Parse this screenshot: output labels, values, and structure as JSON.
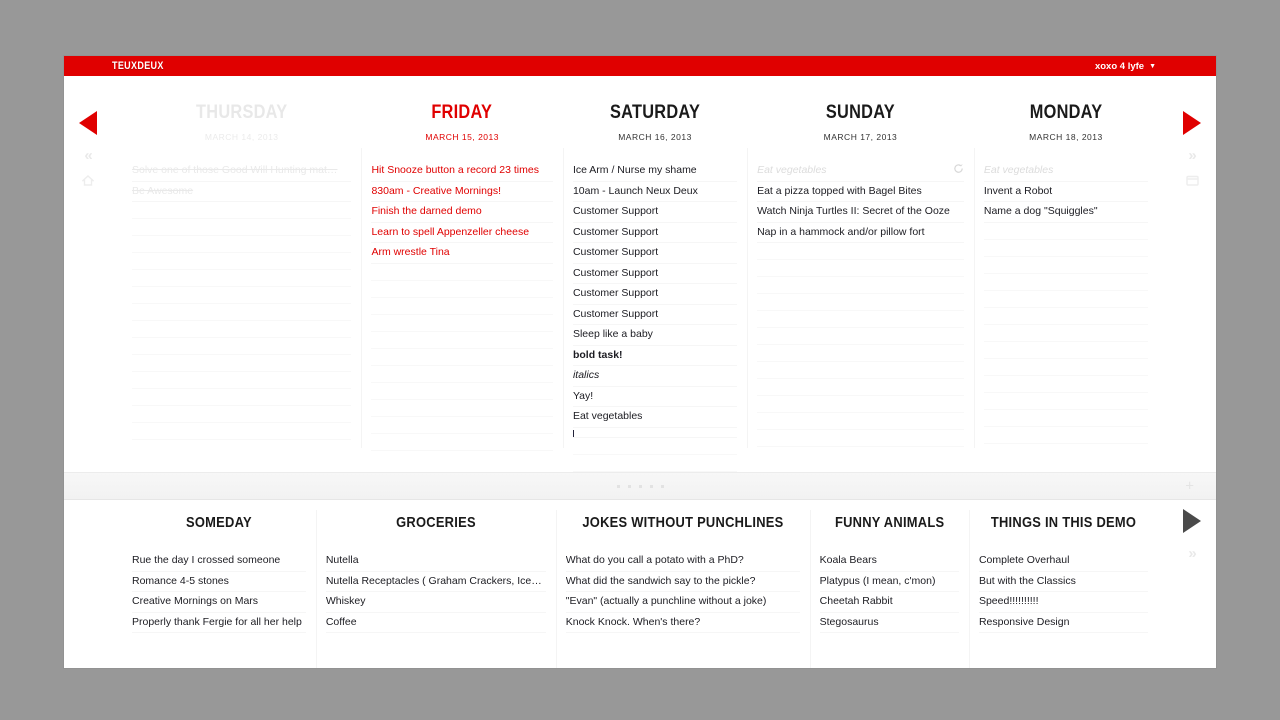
{
  "header": {
    "logo": "TEUXDEUX",
    "account_label": "xoxo 4 lyfe",
    "caret": "▼",
    "brand_color": "#e00000"
  },
  "nav": {
    "prev_week_icon": "chevron-left-icon",
    "next_week_icon": "chevron-right-icon",
    "prev_far_label": "«",
    "next_far_label": "»",
    "home_icon": "home-icon",
    "calendar_icon": "calendar-icon",
    "lists_next_label": "»"
  },
  "divider": {
    "add_label": "+",
    "grip_dots": 5
  },
  "days": [
    {
      "name": "THURSDAY",
      "date": "MARCH 14, 2013",
      "state": "past",
      "tasks": [
        {
          "text": "Solve one of those Good Will Hunting mat…",
          "style": "done"
        },
        {
          "text": "Be Awesome",
          "style": "done"
        }
      ]
    },
    {
      "name": "FRIDAY",
      "date": "MARCH 15, 2013",
      "state": "today",
      "tasks": [
        {
          "text": "Hit Snooze button a record 23 times",
          "style": "normal"
        },
        {
          "text": "830am - Creative Mornings!",
          "style": "normal"
        },
        {
          "text": "Finish the darned demo",
          "style": "normal"
        },
        {
          "text": "Learn to spell Appenzeller cheese",
          "style": "normal"
        },
        {
          "text": "Arm wrestle Tina",
          "style": "normal"
        }
      ]
    },
    {
      "name": "SATURDAY",
      "date": "MARCH 16, 2013",
      "state": "future",
      "tasks": [
        {
          "text": "Ice Arm / Nurse my shame",
          "style": "normal"
        },
        {
          "text": "10am - Launch Neux Deux",
          "style": "normal"
        },
        {
          "text": "Customer Support",
          "style": "normal"
        },
        {
          "text": "Customer Support",
          "style": "normal"
        },
        {
          "text": "Customer Support",
          "style": "normal"
        },
        {
          "text": "Customer Support",
          "style": "normal"
        },
        {
          "text": "Customer Support",
          "style": "normal"
        },
        {
          "text": "Customer Support",
          "style": "normal"
        },
        {
          "text": "Sleep like a baby",
          "style": "normal"
        },
        {
          "text": "bold task!",
          "style": "bold"
        },
        {
          "text": "italics",
          "style": "italic"
        },
        {
          "text": "Yay!",
          "style": "normal"
        },
        {
          "text": "Eat vegetables",
          "style": "normal"
        },
        {
          "text": "",
          "style": "editing"
        }
      ]
    },
    {
      "name": "SUNDAY",
      "date": "MARCH 17, 2013",
      "state": "future",
      "tasks": [
        {
          "text": "Eat vegetables",
          "style": "recurring",
          "icon": "repeat-icon"
        },
        {
          "text": "Eat a pizza topped with Bagel Bites",
          "style": "normal"
        },
        {
          "text": "Watch Ninja Turtles II: Secret of the Ooze",
          "style": "normal"
        },
        {
          "text": "Nap in a hammock and/or pillow fort",
          "style": "normal"
        }
      ]
    },
    {
      "name": "MONDAY",
      "date": "MARCH 18, 2013",
      "state": "future",
      "tasks": [
        {
          "text": "Eat vegetables",
          "style": "recurring"
        },
        {
          "text": "Invent a Robot",
          "style": "normal"
        },
        {
          "text": "Name a dog \"Squiggles\"",
          "style": "normal"
        }
      ]
    }
  ],
  "lists": [
    {
      "name": "SOMEDAY",
      "items": [
        "Rue the day I crossed someone",
        "Romance 4-5 stones",
        "Creative Mornings on Mars",
        "Properly thank Fergie for all her help"
      ]
    },
    {
      "name": "GROCERIES",
      "items": [
        "Nutella",
        "Nutella Receptacles ( Graham Crackers, Ice…",
        "Whiskey",
        "Coffee"
      ]
    },
    {
      "name": "JOKES WITHOUT PUNCHLINES",
      "items": [
        "What do you call a potato with a PhD?",
        "What did the sandwich say to the pickle?",
        "\"Evan\" (actually a punchline without a joke)",
        "Knock Knock. When's there?"
      ]
    },
    {
      "name": "FUNNY ANIMALS",
      "items": [
        "Koala Bears",
        "Platypus (I mean, c'mon)",
        "Cheetah Rabbit",
        "Stegosaurus"
      ]
    },
    {
      "name": "THINGS IN THIS DEMO",
      "items": [
        "Complete Overhaul",
        "But with the Classics",
        "Speed!!!!!!!!!!",
        "Responsive Design"
      ]
    }
  ]
}
